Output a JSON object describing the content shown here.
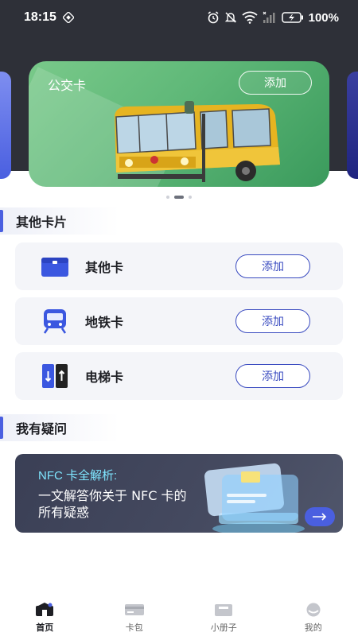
{
  "status_bar": {
    "time": "18:15",
    "battery": "100%",
    "icons": [
      "nfc-icon",
      "alarm-icon",
      "mute-icon",
      "wifi-icon",
      "signal-icon",
      "battery-icon"
    ]
  },
  "carousel": {
    "card_title": "公交卡",
    "add_label": "添加",
    "slide_count": 3,
    "active_slide": 2
  },
  "other_cards": {
    "section_title": "其他卡片",
    "items": [
      {
        "label": "其他卡",
        "add_label": "添加",
        "icon": "card-wallet-icon"
      },
      {
        "label": "地铁卡",
        "add_label": "添加",
        "icon": "metro-train-icon"
      },
      {
        "label": "电梯卡",
        "add_label": "添加",
        "icon": "elevator-icon"
      }
    ]
  },
  "faq": {
    "section_title": "我有疑问",
    "banner_title": "NFC 卡全解析:",
    "banner_text": "一文解答你关于 NFC 卡的所有疑惑"
  },
  "tabbar": {
    "items": [
      {
        "label": "首页",
        "icon": "home-icon",
        "active": true
      },
      {
        "label": "卡包",
        "icon": "card-pack-icon",
        "active": false
      },
      {
        "label": "小册子",
        "icon": "booklet-icon",
        "active": false
      },
      {
        "label": "我的",
        "icon": "profile-icon",
        "active": false
      }
    ]
  },
  "colors": {
    "header_bg": "#2e3038",
    "accent": "#4a5fe0",
    "bus_card": "#5fb878",
    "row_bg": "#f4f5f9",
    "button_outline": "#3a4bc0",
    "banner_accent": "#7fe6ff"
  }
}
